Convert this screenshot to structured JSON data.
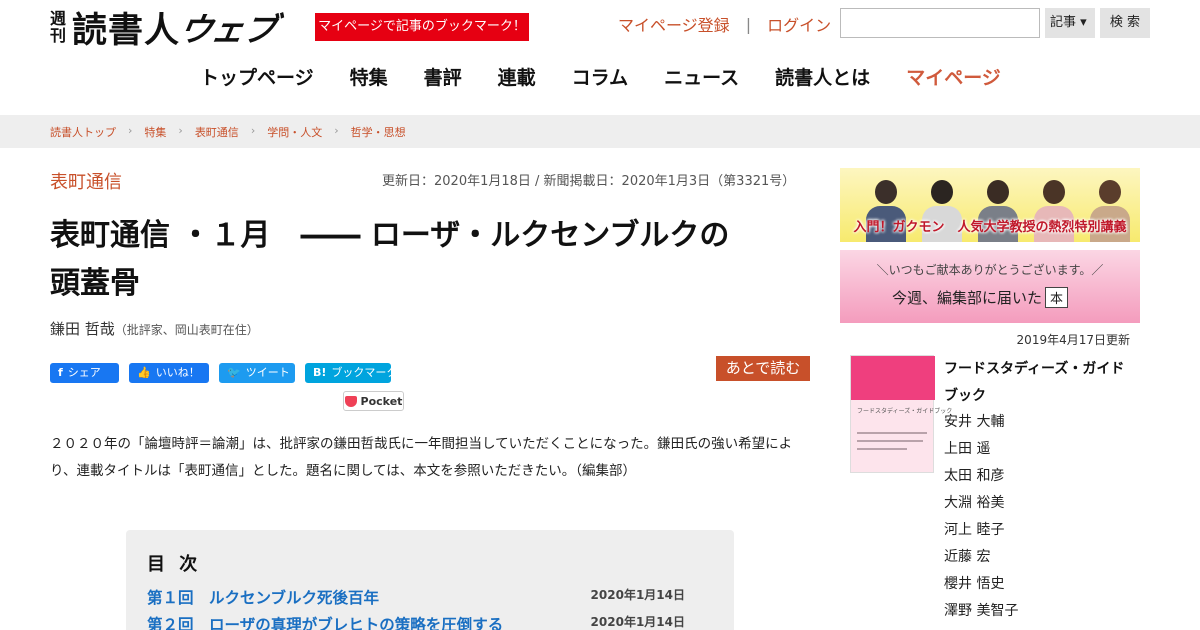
{
  "header": {
    "logo_week_top": "週",
    "logo_week_bottom": "刊",
    "logo_main": "読書人",
    "logo_web": "ウェブ",
    "mypage_promo": "マイページで記事のブックマーク！",
    "register_link": "マイページ登録",
    "separator": "|",
    "login_link": "ログイン",
    "search_placeholder": "",
    "search_select_value": "記事 ▾",
    "search_button": "検 索"
  },
  "nav": {
    "items": [
      "トップページ",
      "特集",
      "書評",
      "連載",
      "コラム",
      "ニュース",
      "読書人とは",
      "マイページ"
    ]
  },
  "breadcrumb": {
    "items": [
      "読書人トップ",
      "特集",
      "表町通信",
      "学問・人文",
      "哲学・思想"
    ]
  },
  "article": {
    "category": "表町通信",
    "dates": "更新日：2020年1月18日 / 新聞掲載日：2020年1月3日（第3321号）",
    "title_line1": "表町通信 ・１月　―― ローザ・ルクセンブルクの",
    "title_line2": "頭蓋骨",
    "author": "鎌田 哲哉",
    "author_note": "（批評家、岡山表町在住）",
    "share": {
      "facebook": "シェア",
      "like": "いいね！",
      "tweet": "ツイート",
      "hatena": "ブックマーク",
      "pocket": "Pocket"
    },
    "read_later": "あとで読む",
    "lead": "２０２０年の「論壇時評＝論潮」は、批評家の鎌田哲哉氏に一年間担当していただくことになった。鎌田氏の強い希望により、連載タイトルは「表町通信」とした。題名に関しては、本文を参照いただきたい。（編集部）"
  },
  "toc": {
    "heading": "目 次",
    "entries": [
      {
        "title": "第１回　ルクセンブルク死後百年",
        "date": "2020年1月14日"
      },
      {
        "title": "第２回　ローザの真理がブレヒトの策略を圧倒する",
        "date": "2020年1月14日"
      }
    ]
  },
  "sidebar": {
    "banner1_text": "入門！ガクモン　人気大学教授の熱烈特別講義",
    "banner2_sub": "＼いつもご献本ありがとうございます。／",
    "banner2_main": "今週、編集部に届いた",
    "banner2_book": "本",
    "updated": "2019年4月17日更新",
    "book_cover_title": "フードスタディーズ・ガイドブック",
    "book_title": "フードスタディーズ・ガイドブック",
    "contributors": [
      "安井 大輔",
      "上田 遥",
      "太田 和彦",
      "大淵 裕美",
      "河上 睦子",
      "近藤 宏",
      "櫻井 悟史",
      "澤野 美智子"
    ]
  },
  "colors": {
    "accent": "#c8502a",
    "promo_red": "#e60012",
    "link_blue": "#1a6fc2",
    "facebook": "#1877f2",
    "twitter": "#1d9bf0",
    "hatena": "#00a4de"
  }
}
